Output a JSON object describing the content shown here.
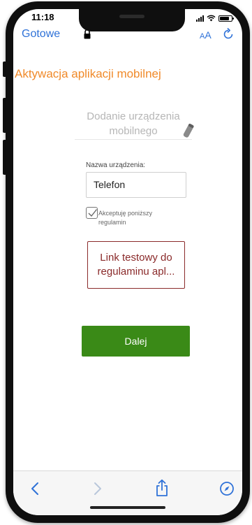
{
  "status_bar": {
    "time": "11:18"
  },
  "browser": {
    "done_label": "Gotowe",
    "text_size_small": "A",
    "text_size_large": "A",
    "accent_color": "#2f72d8"
  },
  "page": {
    "title": "Aktywacja aplikacji mobilnej",
    "device_section_title": "Dodanie urządzenia mobilnego",
    "device_name_label": "Nazwa urządzenia:",
    "device_name_value": "Telefon",
    "accept_checked": true,
    "accept_label": "Akceptuję poniższy regulamin",
    "terms_link_label": "Link testowy do regulaminu apl...",
    "next_button_label": "Dalej",
    "title_color": "#f08a2a",
    "button_color": "#3a8a17",
    "link_color": "#8a2a2a"
  },
  "toolbar": {
    "icons": [
      "back-icon",
      "forward-icon",
      "share-icon",
      "compass-icon"
    ]
  }
}
